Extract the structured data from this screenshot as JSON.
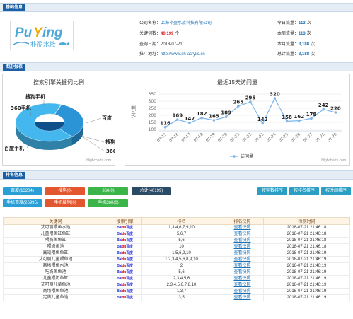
{
  "sections": {
    "basic": "基础信息",
    "charts": "图形报表",
    "ranking": "排名信息"
  },
  "logo": {
    "text_top": "PuYing",
    "text_bottom": "朴盈水族",
    "colors": {
      "brand": "#4ea8d9",
      "accent": "#f0a800"
    }
  },
  "info": {
    "company_label": "公司名称：",
    "company": "上海朴盈水族科技有限公司",
    "keywords_label": "关键词数：",
    "keywords": "40,199",
    "keywords_unit": "个",
    "date_label": "查询日期：",
    "date": "2018-07-21",
    "site_label": "推广地址：",
    "site": "http://www.sh-acrylic.cn"
  },
  "traffic": [
    {
      "label": "今日流量：",
      "value": "113",
      "unit": "次"
    },
    {
      "label": "本周流量：",
      "value": "113",
      "unit": "次"
    },
    {
      "label": "本月流量：",
      "value": "3,188",
      "unit": "次"
    },
    {
      "label": "总计流量：",
      "value": "3,188",
      "unit": "次"
    }
  ],
  "credit": "Highcharts.com",
  "chart_data": [
    {
      "type": "pie",
      "title": "搜索引擎关键词比例",
      "labels": [
        "百度",
        "搜狗",
        "360",
        "百度手机",
        "360手机",
        "搜狗手机"
      ],
      "values": [
        13204,
        1,
        0,
        26995,
        0,
        1
      ],
      "colors": [
        "#2b94d6",
        "#1b6fb0",
        "#123f70",
        "#44b8ee",
        "#66c6f0",
        "#89d4f3"
      ]
    },
    {
      "type": "line",
      "title": "最近15天访问量",
      "categories": [
        "07-15",
        "07-16",
        "07-17",
        "07-18",
        "07-19",
        "07-20",
        "07-21",
        "07-22",
        "07-23",
        "07-24",
        "07-25",
        "07-26",
        "07-27",
        "07-28",
        "07-29"
      ],
      "series": [
        {
          "name": "访问量",
          "values": [
            116,
            169,
            147,
            182,
            165,
            189,
            265,
            295,
            142,
            320,
            158,
            162,
            178,
            242,
            220
          ]
        }
      ],
      "ylabel": "访问量",
      "yticks": [
        "100",
        "150",
        "200",
        "250",
        "300",
        "350"
      ],
      "ylim": [
        90,
        360
      ],
      "color": "#7cb5ec"
    }
  ],
  "buttons_row1": [
    {
      "label": "百度(13204)",
      "color": "blue"
    },
    {
      "label": "搜狗(0)",
      "color": "red"
    },
    {
      "label": "360(0)",
      "color": "green"
    },
    {
      "label": "总计(40199)",
      "color": "dark"
    }
  ],
  "buttons_row2": [
    {
      "label": "手机百度(26995)",
      "color": "blue"
    },
    {
      "label": "手机搜狗(0)",
      "color": "red"
    },
    {
      "label": "手机360(0)",
      "color": "green"
    }
  ],
  "sort_buttons": [
    "按字数排序",
    "按排名排序",
    "按时间排序"
  ],
  "table": {
    "headers": [
      "关键词",
      "搜索引擎",
      "排名",
      "排名快照",
      "检测时间"
    ],
    "rows": [
      {
        "kw": "艾可丽喂鱼水池",
        "rank": "1,3,4,6,7,9,10",
        "snap": "查看快照",
        "time": "2018-07-21 21:46:18"
      },
      {
        "kw": "儿童喂鱼缸鱼缸",
        "rank": "5,6,7",
        "snap": "查看快照",
        "time": "2018-07-21 21:46:18"
      },
      {
        "kw": "喂奶鱼鱼缸",
        "rank": "5,6",
        "snap": "查看快照",
        "time": "2018-07-21 21:46:18"
      },
      {
        "kw": "喂奶鱼池",
        "rank": "10",
        "snap": "查看快照",
        "time": "2018-07-21 21:46:18"
      },
      {
        "kw": "高端喂鱼鱼缸",
        "rank": "1,5,6,9,10",
        "snap": "查看快照",
        "time": "2018-07-21 21:46:19"
      },
      {
        "kw": "艾可丽儿童喂鱼池",
        "rank": "1,2,3,4,5,6,8,9,10",
        "snap": "查看快照",
        "time": "2018-07-21 21:46:19"
      },
      {
        "kw": "商场喂鱼水池",
        "rank": "2",
        "snap": "查看快照",
        "time": "2018-07-21 21:46:19"
      },
      {
        "kw": "吃奶鱼鱼池",
        "rank": "5,6",
        "snap": "查看快照",
        "time": "2018-07-21 21:46:19"
      },
      {
        "kw": "儿童喂奶鱼缸",
        "rank": "2,3,4,5,6",
        "snap": "查看快照",
        "time": "2018-07-21 21:46:19"
      },
      {
        "kw": "艾可丽儿童鱼池",
        "rank": "2,3,4,5,6,7,8,10",
        "snap": "查看快照",
        "time": "2018-07-21 21:46:19"
      },
      {
        "kw": "商场喂鱼鱼池",
        "rank": "1,3,7",
        "snap": "查看快照",
        "time": "2018-07-21 21:46:19"
      },
      {
        "kw": "定做儿童鱼池",
        "rank": "3,5",
        "snap": "查看快照",
        "time": "2018-07-21 21:46:19"
      }
    ]
  }
}
